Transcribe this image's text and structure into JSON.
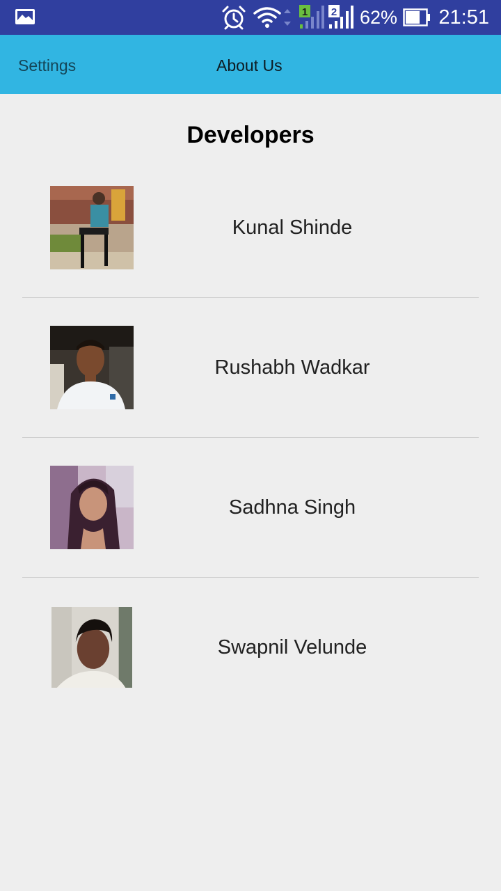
{
  "status_bar": {
    "battery_percent": "62%",
    "time": "21:51",
    "icons": [
      "gallery-icon",
      "alarm-icon",
      "wifi-icon",
      "sim1-signal-icon",
      "sim2-signal-icon",
      "battery-icon"
    ]
  },
  "app_bar": {
    "tabs": [
      {
        "label": "Settings"
      },
      {
        "label": "About Us"
      }
    ]
  },
  "content": {
    "title": "Developers",
    "developers": [
      {
        "name": "Kunal Shinde"
      },
      {
        "name": "Rushabh Wadkar"
      },
      {
        "name": "Sadhna Singh"
      },
      {
        "name": "Swapnil Velunde"
      }
    ]
  },
  "colors": {
    "status_bar": "#303f9f",
    "app_bar": "#31b5e2",
    "background": "#eeeeee"
  }
}
